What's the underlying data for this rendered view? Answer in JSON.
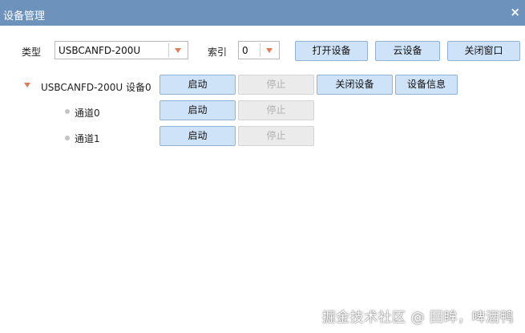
{
  "window": {
    "title": "设备管理",
    "close_glyph": "×"
  },
  "toolbar": {
    "type_label": "类型",
    "type_value": "USBCANFD-200U",
    "index_label": "索引",
    "index_value": "0",
    "open_device": "打开设备",
    "cloud_device": "云设备",
    "close_window": "关闭窗口"
  },
  "device": {
    "name": "USBCANFD-200U 设备0",
    "start": "启动",
    "stop": "停止",
    "close_device": "关闭设备",
    "device_info": "设备信息"
  },
  "channels": [
    {
      "name": "通道0",
      "start": "启动",
      "stop": "停止"
    },
    {
      "name": "通道1",
      "start": "启动",
      "stop": "停止"
    }
  ],
  "watermark": "掘金技术社区 @ 回眸，啤酒鸭",
  "colors": {
    "titlebar": "#6d93bd",
    "button": "#cfe3f8",
    "button_border": "#8fb2d6",
    "arrow": "#e07a5a"
  }
}
